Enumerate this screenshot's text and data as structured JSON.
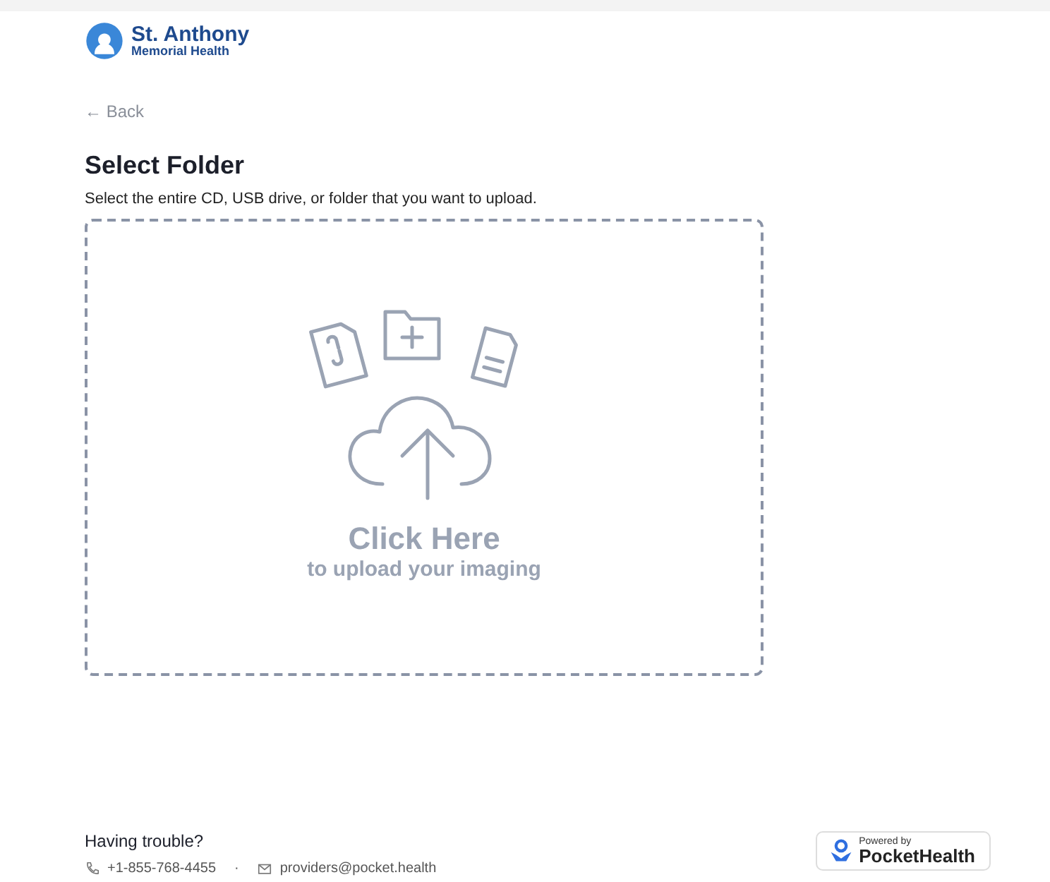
{
  "header": {
    "logo_line1": "St. Anthony",
    "logo_line2": "Memorial Health"
  },
  "back_link": "← Back",
  "title": "Select Folder",
  "subtitle": "Select the entire CD, USB drive, or folder that you want to upload.",
  "dropzone": {
    "heading": "Click Here",
    "subheading": "to upload your imaging"
  },
  "footer": {
    "help_title": "Having trouble?",
    "phone": "+1-855-768-4455",
    "separator": "·",
    "email": "providers@pocket.health",
    "badge_small": "Powered by",
    "badge_brand": "PocketHealth"
  }
}
